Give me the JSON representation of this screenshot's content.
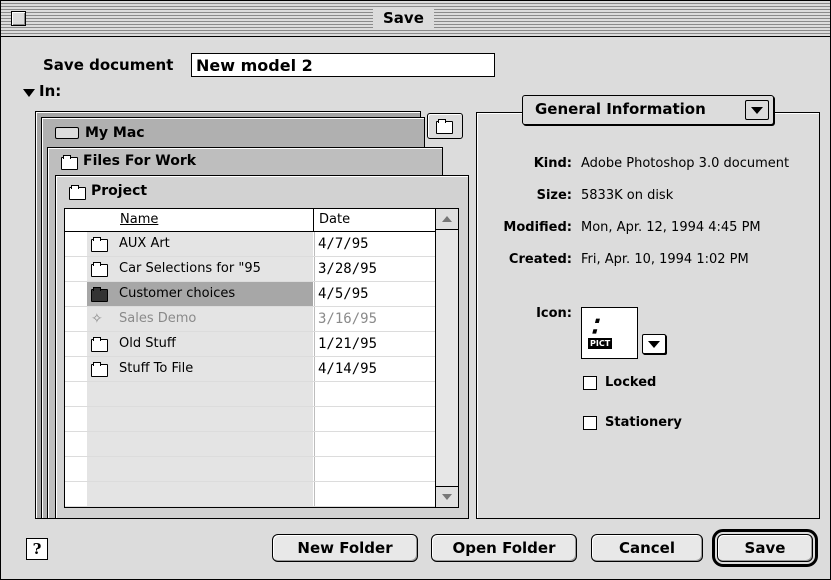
{
  "window": {
    "title": "Save"
  },
  "form": {
    "save_label": "Save document",
    "document_name": "New model 2",
    "in_label": "In:"
  },
  "path": {
    "volume": "My Mac",
    "parent": "Files For Work",
    "current": "Project"
  },
  "list": {
    "col_name": "Name",
    "col_date": "Date",
    "rows": [
      {
        "name": "AUX Art",
        "date": "4/7/95",
        "icon": "folder-icon"
      },
      {
        "name": "Car Selections for \"95",
        "date": "3/28/95",
        "icon": "folder-icon"
      },
      {
        "name": "Customer choices",
        "date": "4/5/95",
        "icon": "folder-icon",
        "selected": true
      },
      {
        "name": "Sales Demo",
        "date": "3/16/95",
        "icon": "app-icon",
        "disabled": true
      },
      {
        "name": "Old Stuff",
        "date": "1/21/95",
        "icon": "folder-icon"
      },
      {
        "name": "Stuff To File",
        "date": "4/14/95",
        "icon": "folder-icon"
      }
    ]
  },
  "info": {
    "popup_label": "General Information",
    "kind_label": "Kind:",
    "kind_value": "Adobe Photoshop 3.0 document",
    "size_label": "Size:",
    "size_value": "5833K on disk",
    "modified_label": "Modified:",
    "modified_value": "Mon, Apr. 12, 1994 4:45 PM",
    "created_label": "Created:",
    "created_value": "Fri, Apr. 10, 1994 1:02 PM",
    "icon_label": "Icon:",
    "locked_label": "Locked",
    "stationery_label": "Stationery"
  },
  "buttons": {
    "help": "?",
    "new_folder": "New Folder",
    "open_folder": "Open Folder",
    "cancel": "Cancel",
    "save": "Save"
  }
}
